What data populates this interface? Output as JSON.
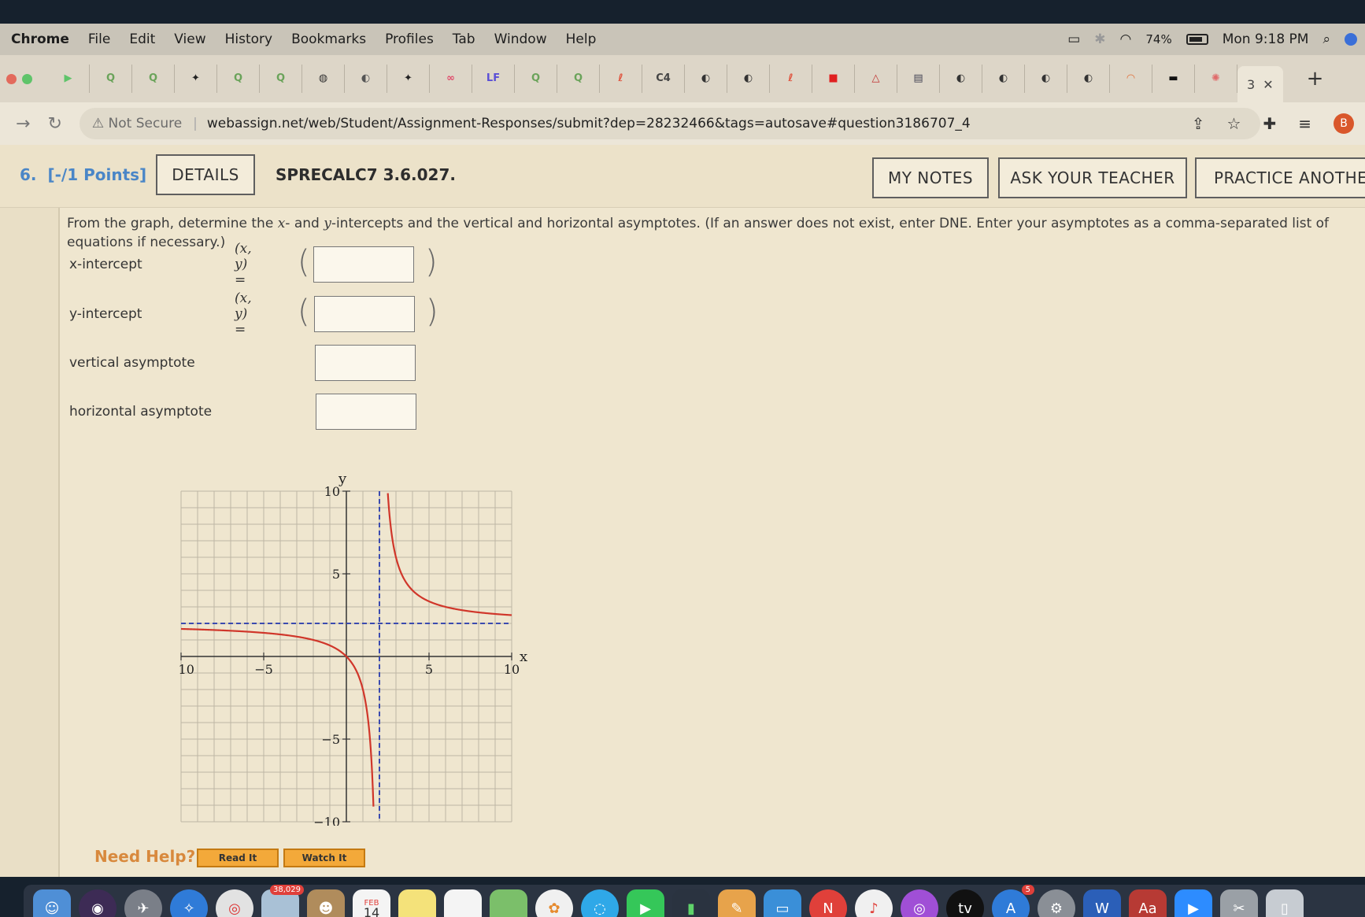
{
  "menubar": {
    "app": "Chrome",
    "items": [
      "File",
      "Edit",
      "View",
      "History",
      "Bookmarks",
      "Profiles",
      "Tab",
      "Window",
      "Help"
    ],
    "battery": "74%",
    "clock": "Mon 9:18 PM"
  },
  "tabs": {
    "active_label": "3",
    "c4_label": "C4"
  },
  "address": {
    "security": "Not Secure",
    "url": "webassign.net/web/Student/Assignment-Responses/submit?dep=28232466&tags=autosave#question3186707_4"
  },
  "question": {
    "number": "6.",
    "points": "[-/1 Points]",
    "details_label": "DETAILS",
    "code": "SPRECALC7 3.6.027.",
    "my_notes": "MY NOTES",
    "ask_teacher": "ASK YOUR TEACHER",
    "practice": "PRACTICE ANOTHER",
    "prompt_a": "From the graph, determine the ",
    "prompt_x": "x",
    "prompt_b": "- and ",
    "prompt_y": "y",
    "prompt_c": "-intercepts and the vertical and horizontal asymptotes. (If an answer does not exist, enter DNE. Enter your asymptotes as a comma-separated list of equations if necessary.)",
    "rows": [
      {
        "label": "x-intercept",
        "eq": "(x, y) =",
        "value": ""
      },
      {
        "label": "y-intercept",
        "eq": "(x, y) =",
        "value": ""
      },
      {
        "label": "vertical asymptote",
        "value": ""
      },
      {
        "label": "horizontal asymptote",
        "value": ""
      }
    ]
  },
  "help": {
    "label": "Need Help?",
    "read": "Read It",
    "watch": "Watch It"
  },
  "dock": {
    "badge_photos": "38,029",
    "calendar_month": "FEB",
    "calendar_day": "14",
    "appstore_badge": "5"
  },
  "chart_data": {
    "type": "line",
    "xlabel": "x",
    "ylabel": "y",
    "xlim": [
      -10,
      10
    ],
    "ylim": [
      -10,
      10
    ],
    "xticks": [
      "-10",
      "-5",
      "5",
      "10"
    ],
    "yticks": [
      "10",
      "5",
      "-5",
      "-10"
    ],
    "grid": true,
    "asymptotes": {
      "vertical_x": 2,
      "horizontal_y": 2
    },
    "function": {
      "a": 4,
      "b": 2,
      "c": 2
    },
    "series_color": "#d0362a",
    "asymptote_color": "#3b4bb0"
  }
}
